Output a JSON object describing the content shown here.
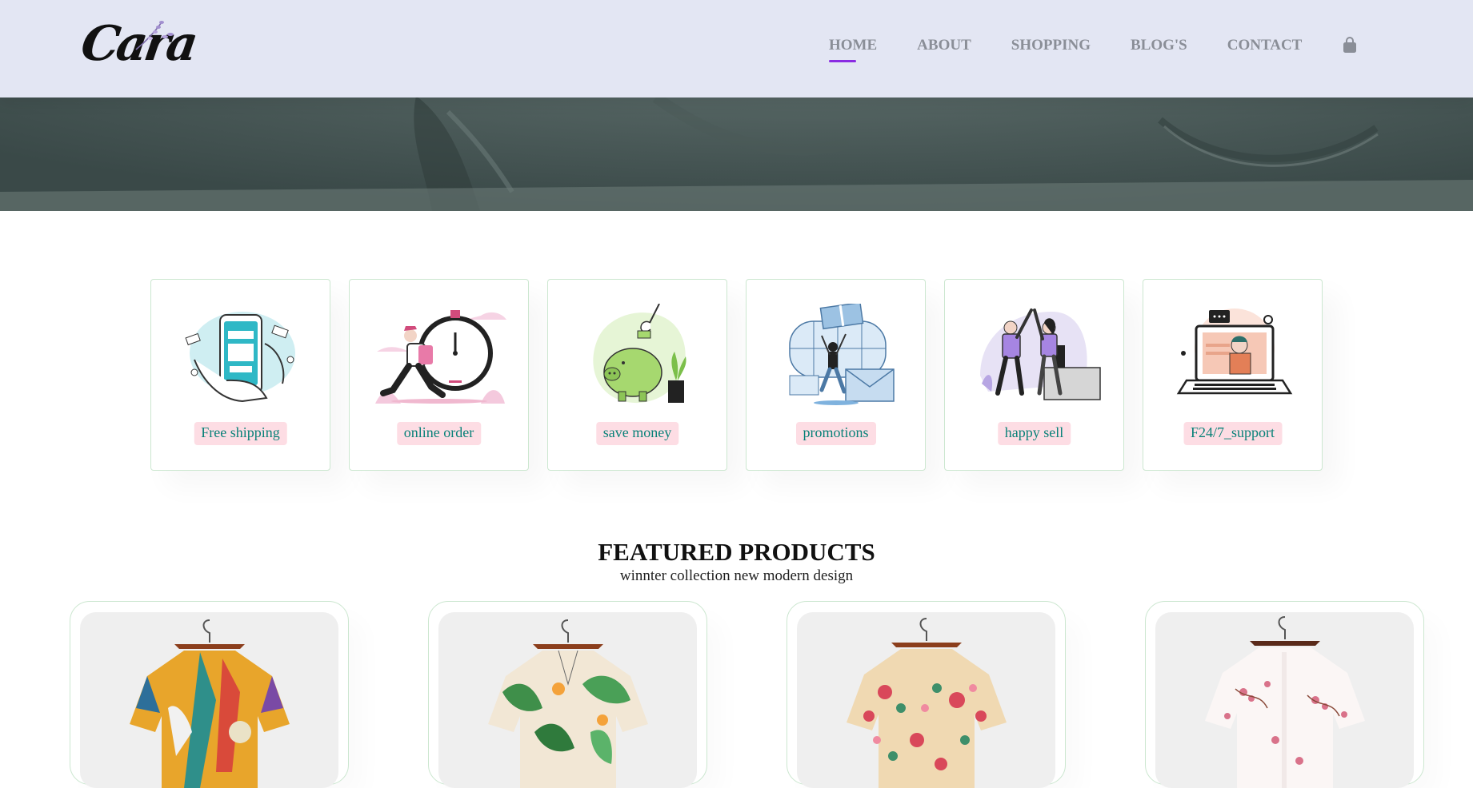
{
  "header": {
    "logo_text": "Cara",
    "nav": [
      {
        "label": "HOME",
        "active": true
      },
      {
        "label": "ABOUT",
        "active": false
      },
      {
        "label": "SHOPPING",
        "active": false
      },
      {
        "label": "BLOG'S",
        "active": false
      },
      {
        "label": "CONTACT",
        "active": false
      }
    ],
    "cart_icon": "shopping-bag-icon"
  },
  "features": [
    {
      "label": "Free shipping",
      "icon": "payment-phone-illustration"
    },
    {
      "label": "online order",
      "icon": "stopwatch-runner-illustration"
    },
    {
      "label": "save money",
      "icon": "piggy-bank-illustration"
    },
    {
      "label": "promotions",
      "icon": "gift-envelope-illustration"
    },
    {
      "label": "happy sell",
      "icon": "high-five-illustration"
    },
    {
      "label": "F24/7_support",
      "icon": "laptop-support-illustration"
    }
  ],
  "featured": {
    "title": "FEATURED PRODUCTS",
    "subtitle": "winnter collection new modern design"
  },
  "products": [
    {
      "image": "colorful-abstract-shirt"
    },
    {
      "image": "green-leaf-shirt"
    },
    {
      "image": "floral-cream-shirt"
    },
    {
      "image": "pink-blossom-white-shirt"
    }
  ],
  "colors": {
    "header_bg": "#e3e6f3",
    "nav_text": "#8a8e97",
    "nav_active_underline": "#8a2be2",
    "feature_label_bg": "#fddde4",
    "feature_label_text": "#088178",
    "card_border": "#cce7d0"
  }
}
